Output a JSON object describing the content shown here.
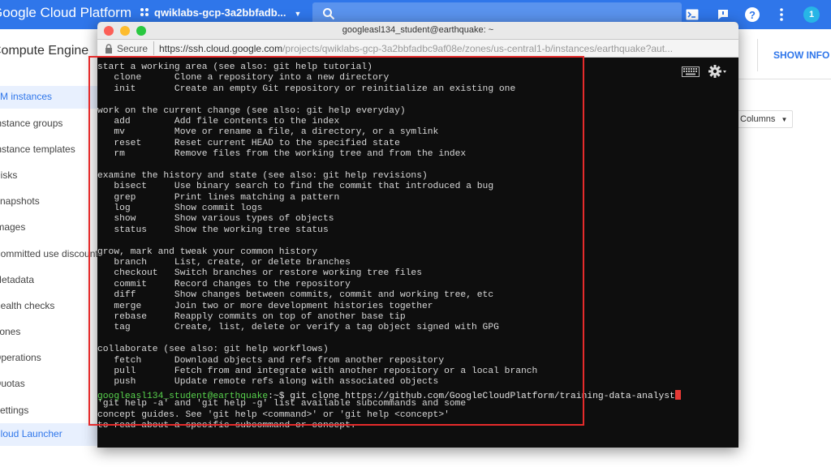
{
  "gcp": {
    "title": "Google Cloud Platform",
    "project": "qwiklabs-gcp-3a2bbfadb...",
    "product": "Compute Engine",
    "show_info": "SHOW INFO P",
    "columns_label": "Columns",
    "avatar_letter": "1",
    "sidebar": [
      {
        "label": "VM instances",
        "top": 0
      },
      {
        "label": "Instance groups",
        "top": 0
      },
      {
        "label": "Instance templates",
        "top": 0
      },
      {
        "label": "Disks",
        "top": 0
      },
      {
        "label": "Snapshots",
        "top": 0
      },
      {
        "label": "Images",
        "top": 0
      },
      {
        "label": "Committed use discounts",
        "top": 0
      },
      {
        "label": "Metadata",
        "top": 0
      },
      {
        "label": "Health checks",
        "top": 0
      },
      {
        "label": "Zones",
        "top": 0
      },
      {
        "label": "Operations",
        "top": 0
      },
      {
        "label": "Quotas",
        "top": 0
      },
      {
        "label": "Settings",
        "top": 0
      },
      {
        "label": "Cloud Launcher",
        "top": 0
      }
    ]
  },
  "ssh": {
    "window_title": "googleasl134_student@earthquake: ~",
    "secure_label": "Secure",
    "url_main": "https://ssh.cloud.google.com",
    "url_rest": "/projects/qwiklabs-gcp-3a2bbfadbc9af08e/zones/us-central1-b/instances/earthquake?aut...",
    "lines": [
      "start a working area (see also: git help tutorial)",
      "   clone      Clone a repository into a new directory",
      "   init       Create an empty Git repository or reinitialize an existing one",
      "",
      "work on the current change (see also: git help everyday)",
      "   add        Add file contents to the index",
      "   mv         Move or rename a file, a directory, or a symlink",
      "   reset      Reset current HEAD to the specified state",
      "   rm         Remove files from the working tree and from the index",
      "",
      "examine the history and state (see also: git help revisions)",
      "   bisect     Use binary search to find the commit that introduced a bug",
      "   grep       Print lines matching a pattern",
      "   log        Show commit logs",
      "   show       Show various types of objects",
      "   status     Show the working tree status",
      "",
      "grow, mark and tweak your common history",
      "   branch     List, create, or delete branches",
      "   checkout   Switch branches or restore working tree files",
      "   commit     Record changes to the repository",
      "   diff       Show changes between commits, commit and working tree, etc",
      "   merge      Join two or more development histories together",
      "   rebase     Reapply commits on top of another base tip",
      "   tag        Create, list, delete or verify a tag object signed with GPG",
      "",
      "collaborate (see also: git help workflows)",
      "   fetch      Download objects and refs from another repository",
      "   pull       Fetch from and integrate with another repository or a local branch",
      "   push       Update remote refs along with associated objects",
      "",
      "'git help -a' and 'git help -g' list available subcommands and some",
      "concept guides. See 'git help <command>' or 'git help <concept>'",
      "to read about a specific subcommand or concept."
    ],
    "prompt_user": "googleasl134_student@earthquake",
    "prompt_rest": ":~$ git clone https://github.com/GoogleCloudPlatform/training-data-analyst"
  }
}
